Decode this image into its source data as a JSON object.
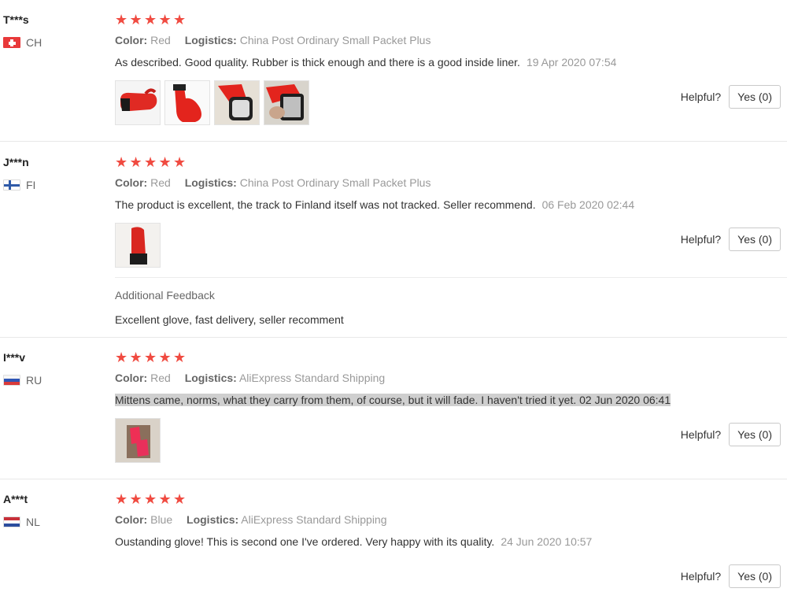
{
  "accent": "#f04b41",
  "reviews": [
    {
      "user": "T***s",
      "country": "CH",
      "stars": 5,
      "color_label": "Color:",
      "color_value": "Red",
      "logistics_label": "Logistics:",
      "logistics_value": "China Post Ordinary Small Packet Plus",
      "text": "As described. Good quality. Rubber is thick enough and there is a good inside liner.",
      "date": "19 Apr 2020 07:54",
      "helpful_label": "Helpful?",
      "yes_label": "Yes (0)"
    },
    {
      "user": "J***n",
      "country": "FI",
      "stars": 5,
      "color_label": "Color:",
      "color_value": "Red",
      "logistics_label": "Logistics:",
      "logistics_value": "China Post Ordinary Small Packet Plus",
      "text": "The product is excellent, the track to Finland itself was not tracked. Seller recommend.",
      "date": "06 Feb 2020 02:44",
      "helpful_label": "Helpful?",
      "yes_label": "Yes (0)",
      "additional_title": "Additional Feedback",
      "additional_text": "Excellent glove, fast delivery, seller recomment"
    },
    {
      "user": "I***v",
      "country": "RU",
      "stars": 5,
      "color_label": "Color:",
      "color_value": "Red",
      "logistics_label": "Logistics:",
      "logistics_value": "AliExpress Standard Shipping",
      "text": "Mittens came, norms, what they carry from them, of course, but it will fade. I haven't tried it yet.",
      "date": "02 Jun 2020 06:41",
      "helpful_label": "Helpful?",
      "yes_label": "Yes (0)"
    },
    {
      "user": "A***t",
      "country": "NL",
      "stars": 5,
      "color_label": "Color:",
      "color_value": "Blue",
      "logistics_label": "Logistics:",
      "logistics_value": "AliExpress Standard Shipping",
      "text": "Oustanding glove! This is second one I've ordered. Very happy with its quality.",
      "date": "24 Jun 2020 10:57",
      "helpful_label": "Helpful?",
      "yes_label": "Yes (0)"
    }
  ]
}
